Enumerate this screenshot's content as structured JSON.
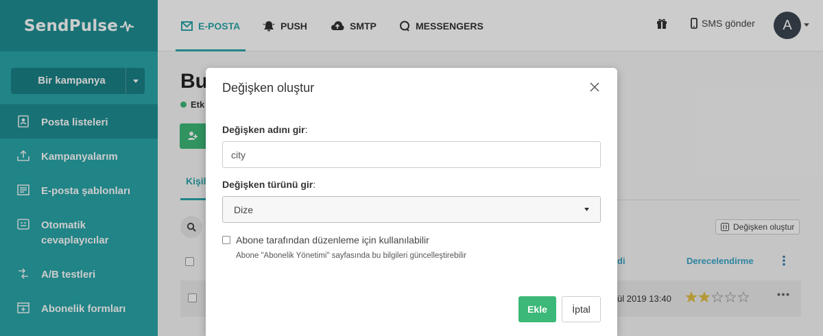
{
  "app": {
    "logo_text": "SendPulse"
  },
  "topbar": {
    "tabs": [
      {
        "label": "E-POSTA",
        "icon": "envelope-icon",
        "active": true
      },
      {
        "label": "PUSH",
        "icon": "bell-icon",
        "active": false
      },
      {
        "label": "SMTP",
        "icon": "cloud-upload-icon",
        "active": false
      },
      {
        "label": "MESSENGERS",
        "icon": "chat-bubble-icon",
        "active": false
      }
    ],
    "sms_label": "SMS gönder",
    "avatar_letter": "A"
  },
  "sidebar": {
    "campaign_button_label": "Bir kampanya",
    "items": [
      {
        "label": "Posta listeleri",
        "icon": "address-book-icon",
        "active": true
      },
      {
        "label": "Kampanyalarım",
        "icon": "outbox-icon",
        "active": false
      },
      {
        "label": "E-posta şablonları",
        "icon": "template-icon",
        "active": false
      },
      {
        "label": "Otomatik cevaplayıcılar",
        "icon": "autoresponder-icon",
        "active": false
      },
      {
        "label": "A/B testleri",
        "icon": "ab-test-icon",
        "active": false
      },
      {
        "label": "Abonelik formları",
        "icon": "form-icon",
        "active": false
      }
    ]
  },
  "page": {
    "title_partial": "Bu",
    "status_partial": "Etk",
    "subtab_partial": "Kişil",
    "var_create_label": "Değişken oluştur",
    "col_partial": "di",
    "col_rating": "Derecelendirme",
    "row_date_partial": "ül 2019 13:40",
    "row_rating": 2,
    "row_rating_max": 5
  },
  "modal": {
    "title": "Değişken oluştur",
    "name_label_bold": "Değişken adını gir",
    "name_label_suffix": ":",
    "name_value": "city",
    "type_label_bold": "Değişken türünü gir",
    "type_label_suffix": ":",
    "type_selected": "Dize",
    "checkbox_label": "Abone tarafından düzenleme için kullanılabilir",
    "checkbox_hint": "Abone \"Abonelik Yönetimi\" sayfasında bu bilgileri güncelleştirebilir",
    "add_label": "Ekle",
    "cancel_label": "İptal"
  },
  "colors": {
    "brand_teal": "#2aa5a9",
    "sidebar_dark": "#1e8f93",
    "success_green": "#3cb878",
    "star_gold": "#e2c046"
  }
}
